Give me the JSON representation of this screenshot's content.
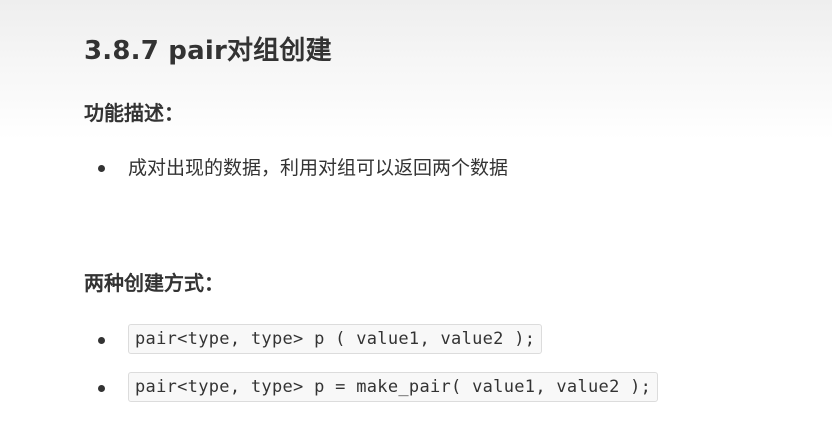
{
  "heading": "3.8.7 pair对组创建",
  "description_section": {
    "title": "功能描述：",
    "items": [
      "成对出现的数据，利用对组可以返回两个数据"
    ]
  },
  "creation_section": {
    "title": "两种创建方式：",
    "code_items": [
      "pair<type, type> p ( value1, value2 );",
      "pair<type, type> p = make_pair( value1, value2 );"
    ]
  }
}
